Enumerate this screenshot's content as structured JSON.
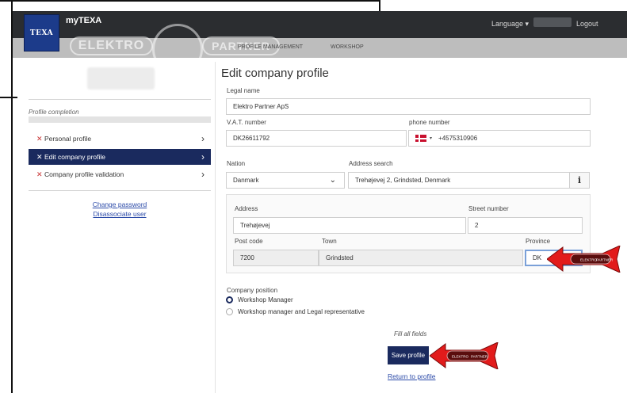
{
  "header": {
    "logo_text": "TEXA",
    "app_title": "myTEXA",
    "language_label": "Language ▾",
    "logout_label": "Logout"
  },
  "subnav": {
    "items": [
      "PROFILE MANAGEMENT",
      "WORKSHOP"
    ],
    "watermark_left": "ELEKTRO",
    "watermark_right": "PARTNER"
  },
  "sidebar": {
    "profile_completion_label": "Profile completion",
    "items": [
      {
        "label": "Personal profile",
        "mark": "✕",
        "active": false
      },
      {
        "label": "Edit company profile",
        "mark": "✕",
        "active": true
      },
      {
        "label": "Company profile validation",
        "mark": "✕",
        "active": false
      }
    ],
    "links": [
      "Change password",
      "Disassociate user"
    ]
  },
  "form": {
    "title": "Edit company profile",
    "legal_name_label": "Legal name",
    "legal_name_value": "Elektro Partner ApS",
    "vat_label": "V.A.T. number",
    "vat_value": "DK26611792",
    "phone_label": "phone number",
    "phone_value": "+4575310906",
    "nation_label": "Nation",
    "nation_value": "Danmark",
    "address_search_label": "Address search",
    "address_search_value": "Trehøjevej 2, Grindsted, Denmark",
    "info_label": "i",
    "address_label": "Address",
    "address_value": "Trehøjevej",
    "street_number_label": "Street number",
    "street_number_value": "2",
    "post_code_label": "Post code",
    "post_code_value": "7200",
    "town_label": "Town",
    "town_value": "Grindsted",
    "province_label": "Province",
    "province_value": "DK",
    "company_position_label": "Company position",
    "positions": [
      {
        "label": "Workshop Manager",
        "selected": true
      },
      {
        "label": "Workshop manager and Legal representative",
        "selected": false
      }
    ],
    "fill_all_text": "Fill all fields",
    "save_label": "Save profile",
    "return_label": "Return to profile"
  },
  "annotation": {
    "arrow_badge_left": "ELEKTRO",
    "arrow_badge_right": "PARTNER"
  },
  "colors": {
    "navbar": "#2b2d30",
    "accent_navy": "#1a2a5e",
    "logo_blue": "#1c3b8a",
    "error_red": "#c83232",
    "arrow_red": "#e21b1b"
  }
}
